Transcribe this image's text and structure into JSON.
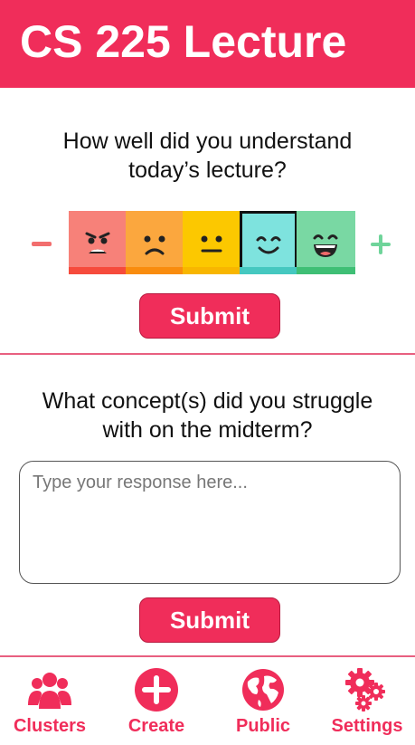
{
  "header": {
    "title": "CS 225 Lecture"
  },
  "question1": {
    "text": "How well did you understand today’s lecture?",
    "scale": [
      {
        "face": "angry-face",
        "color": "#f78179",
        "bar": "#f64b3c"
      },
      {
        "face": "sad-face",
        "color": "#fba73e",
        "bar": "#f98c0e"
      },
      {
        "face": "neutral-face",
        "color": "#fcc800",
        "bar": "#f8b600"
      },
      {
        "face": "smile-face",
        "color": "#7ee3de",
        "bar": "#45c8c0",
        "selected": true
      },
      {
        "face": "grin-face",
        "color": "#79d8a3",
        "bar": "#3fbf75"
      }
    ],
    "submit_label": "Submit"
  },
  "question2": {
    "text": "What concept(s) did you struggle with on the midterm?",
    "placeholder": "Type your response here...",
    "value": "",
    "submit_label": "Submit"
  },
  "nav": {
    "items": [
      {
        "label": "Clusters",
        "icon": "users-icon"
      },
      {
        "label": "Create",
        "icon": "plus-circle-icon"
      },
      {
        "label": "Public",
        "icon": "globe-icon"
      },
      {
        "label": "Settings",
        "icon": "gears-icon"
      }
    ]
  },
  "colors": {
    "accent": "#f02d5a",
    "minus": "#f26e6e",
    "plus": "#6fd49a"
  }
}
